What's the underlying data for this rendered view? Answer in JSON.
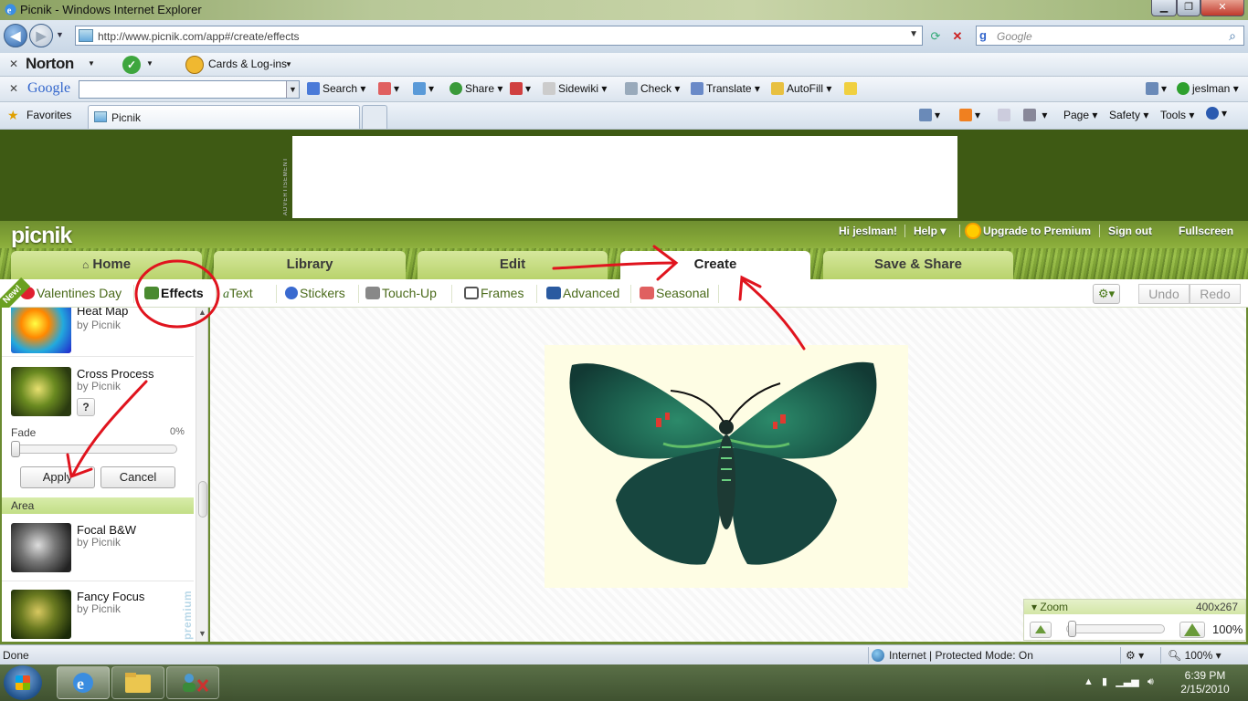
{
  "browser": {
    "window_title": "Picnik - Windows Internet Explorer",
    "url": "http://www.picnik.com/app#/create/effects",
    "search_placeholder": "Google",
    "tab_label": "Picnik",
    "favorites_label": "Favorites"
  },
  "norton_toolbar": {
    "logo": "Norton",
    "cards_label": "Cards & Log-ins"
  },
  "google_toolbar": {
    "logo": "Google",
    "search_label": "Search",
    "share_label": "Share",
    "sidewiki_label": "Sidewiki",
    "check_label": "Check",
    "translate_label": "Translate",
    "autofill_label": "AutoFill",
    "user_label": "jeslman"
  },
  "command_bar": {
    "page_label": "Page",
    "safety_label": "Safety",
    "tools_label": "Tools"
  },
  "ad": {
    "label": "ADVERTISEMENT"
  },
  "picnik": {
    "logo": "picnik",
    "header_links": {
      "greeting": "Hi jeslman!",
      "help": "Help",
      "upgrade": "Upgrade to Premium",
      "signout": "Sign out",
      "fullscreen": "Fullscreen"
    },
    "main_tabs": [
      "Home",
      "Library",
      "Edit",
      "Create",
      "Save & Share"
    ],
    "active_tab": "Create",
    "sub_tabs": [
      "Valentines Day",
      "Effects",
      "Text",
      "Stickers",
      "Touch-Up",
      "Frames",
      "Advanced",
      "Seasonal"
    ],
    "active_sub_tab": "Effects",
    "new_badge": "New!",
    "undo": "Undo",
    "redo": "Redo"
  },
  "effects_panel": {
    "top_effect": {
      "name": "Heat Map",
      "author": "by Picnik"
    },
    "selected_effect": {
      "name": "Cross Process",
      "author": "by Picnik",
      "help": "?",
      "fade_label": "Fade",
      "fade_value": "0%",
      "apply": "Apply",
      "cancel": "Cancel"
    },
    "section_title": "Area",
    "area_effects": [
      {
        "name": "Focal B&W",
        "author": "by Picnik"
      },
      {
        "name": "Fancy Focus",
        "author": "by Picnik"
      }
    ],
    "premium_label": "premium"
  },
  "zoom": {
    "title": "Zoom",
    "image_size": "400x267",
    "level": "100%"
  },
  "status_bar": {
    "status": "Done",
    "zone": "Internet | Protected Mode: On",
    "zoom": "100%"
  },
  "taskbar": {
    "time": "6:39 PM",
    "date": "2/15/2010"
  },
  "colors": {
    "picnik_green": "#86a838",
    "tab_green": "#c5dc84",
    "annotation_red": "#e0141e"
  }
}
